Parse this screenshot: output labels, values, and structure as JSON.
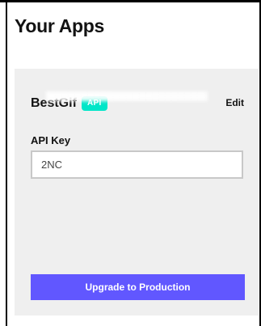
{
  "page": {
    "title": "Your Apps"
  },
  "app_card": {
    "name": "BestGif",
    "badge": "API",
    "edit_label": "Edit",
    "api_key_label": "API Key",
    "api_key_value": "2NC",
    "upgrade_label": "Upgrade to Production"
  },
  "colors": {
    "badge": "#00e6c8",
    "button": "#6157ff",
    "card_background": "#efefef"
  }
}
